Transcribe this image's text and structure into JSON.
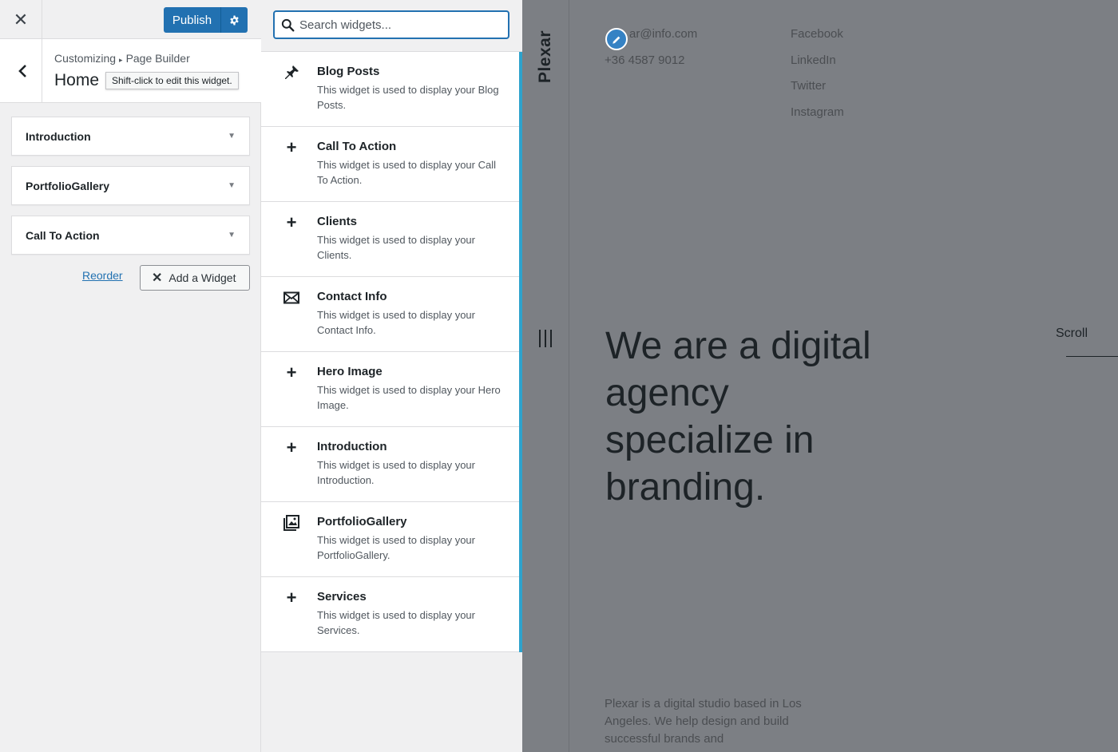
{
  "topbar": {
    "close_glyph": "✕",
    "publish_label": "Publish",
    "settings_icon": "gear-icon"
  },
  "section": {
    "breadcrumb_root": "Customizing",
    "breadcrumb_separator": "▸",
    "breadcrumb_current": "Page Builder",
    "title": "Home",
    "tooltip": "Shift-click to edit this widget."
  },
  "placed_widgets": [
    {
      "label": "Introduction"
    },
    {
      "label": "PortfolioGallery"
    },
    {
      "label": "Call To Action"
    }
  ],
  "actions": {
    "reorder_label": "Reorder",
    "add_widget_label": "Add a Widget"
  },
  "search": {
    "placeholder": "Search widgets..."
  },
  "available_widgets": [
    {
      "icon": "pin-icon",
      "title": "Blog Posts",
      "description": "This widget is used to display your Blog Posts."
    },
    {
      "icon": "plus-icon",
      "title": "Call To Action",
      "description": "This widget is used to display your Call To Action."
    },
    {
      "icon": "plus-icon",
      "title": "Clients",
      "description": "This widget is used to display your Clients."
    },
    {
      "icon": "envelope-icon",
      "title": "Contact Info",
      "description": "This widget is used to display your Contact Info."
    },
    {
      "icon": "plus-icon",
      "title": "Hero Image",
      "description": "This widget is used to display your Hero Image."
    },
    {
      "icon": "plus-icon",
      "title": "Introduction",
      "description": "This widget is used to display your Introduction."
    },
    {
      "icon": "gallery-icon",
      "title": "PortfolioGallery",
      "description": "This widget is used to display your PortfolioGallery."
    },
    {
      "icon": "plus-icon",
      "title": "Services",
      "description": "This widget is used to display your Services."
    }
  ],
  "preview": {
    "brand": "Plexar",
    "email": "ar@info.com",
    "phone": "+36 4587 9012",
    "social": [
      "Facebook",
      "LinkedIn",
      "Twitter",
      "Instagram"
    ],
    "hero": "We are a digital agency specialize in branding.",
    "scroll_label": "Scroll",
    "about": "Plexar is a digital studio based in Los Angeles. We help design and build successful brands and"
  },
  "colors": {
    "accent": "#2271b1",
    "list_border": "#2ea2cc",
    "overlay": "#7c7f84"
  }
}
